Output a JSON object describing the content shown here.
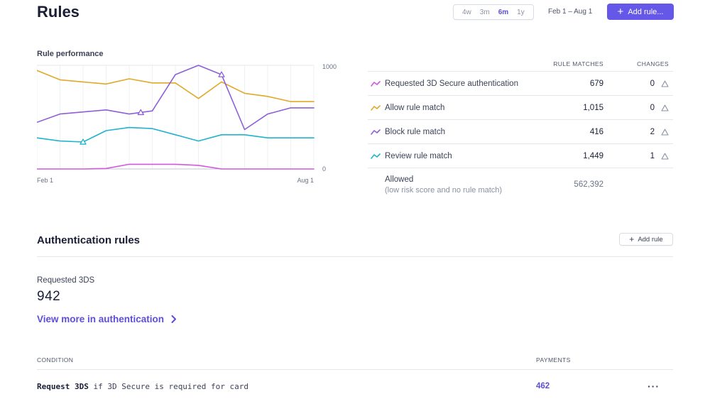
{
  "header": {
    "title": "Rules",
    "ranges": [
      "4w",
      "3m",
      "6m",
      "1y"
    ],
    "active_range": "6m",
    "date_range": "Feb 1 – Aug 1",
    "add_rule_label": "Add rule..."
  },
  "performance": {
    "title": "Rule performance",
    "columns": {
      "matches": "RULE MATCHES",
      "changes": "CHANGES"
    },
    "rules": [
      {
        "name": "Requested 3D Secure authentication",
        "matches": "679",
        "changes": "0",
        "color": "#d457e0"
      },
      {
        "name": "Allow rule match",
        "matches": "1,015",
        "changes": "0",
        "color": "#e0a92a"
      },
      {
        "name": "Block rule match",
        "matches": "416",
        "changes": "2",
        "color": "#8e5fd8"
      },
      {
        "name": "Review rule match",
        "matches": "1,449",
        "changes": "1",
        "color": "#1fb3cf"
      }
    ],
    "allowed": {
      "label": "Allowed",
      "sub": "(low risk score and no rule match)",
      "value": "562,392"
    }
  },
  "chart_data": {
    "type": "line",
    "x_labels": {
      "start": "Feb 1",
      "end": "Aug 1"
    },
    "y_ticks": {
      "top": "1000",
      "bottom": "0"
    },
    "ylim": [
      0,
      1000
    ],
    "grid": true,
    "series": [
      {
        "name": "Requested 3D Secure authentication",
        "color": "#d457e0",
        "values": [
          0,
          0,
          0,
          5,
          45,
          45,
          45,
          35,
          0,
          0,
          0,
          0,
          0
        ],
        "markers": []
      },
      {
        "name": "Allow rule match",
        "color": "#e0a92a",
        "values": [
          950,
          860,
          840,
          820,
          870,
          830,
          830,
          680,
          840,
          730,
          700,
          650,
          650
        ],
        "markers": []
      },
      {
        "name": "Block rule match",
        "color": "#8e5fd8",
        "values": [
          450,
          530,
          550,
          570,
          530,
          560,
          910,
          1000,
          910,
          380,
          530,
          590,
          590
        ],
        "markers": [
          4.5,
          8
        ]
      },
      {
        "name": "Review rule match",
        "color": "#1fb3cf",
        "values": [
          300,
          270,
          260,
          370,
          400,
          390,
          330,
          270,
          330,
          330,
          300,
          300,
          300
        ],
        "markers": [
          2
        ]
      }
    ]
  },
  "auth": {
    "title": "Authentication rules",
    "add_rule_label": "Add rule",
    "metric_label": "Requested 3DS",
    "metric_value": "942",
    "view_more": "View more in authentication",
    "condition_header": "CONDITION",
    "payments_header": "PAYMENTS",
    "condition_keyword": "Request 3DS",
    "condition_rest": " if 3D Secure is required for card",
    "payments_value": "462",
    "more_label": "···"
  }
}
